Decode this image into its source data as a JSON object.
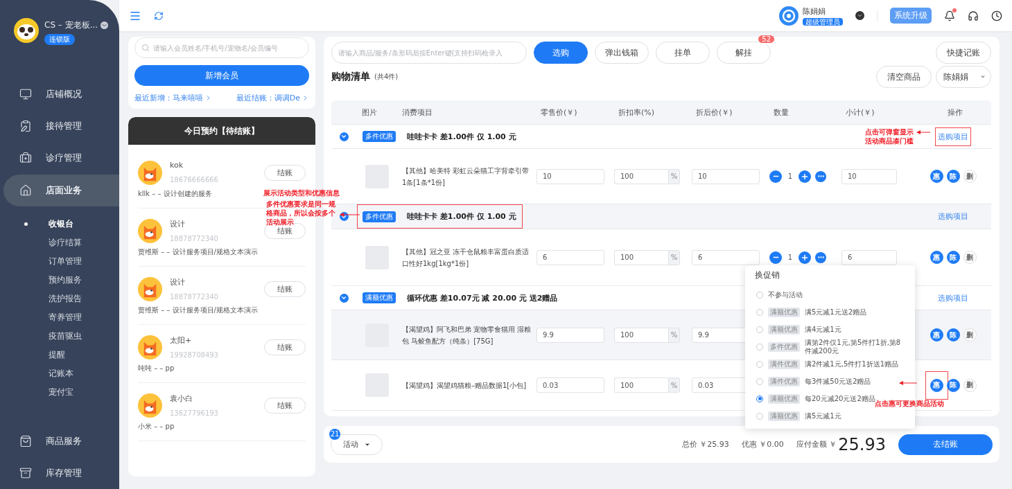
{
  "sidebar": {
    "brand": {
      "name": "CS – 宠老板...",
      "badge": "连锁版"
    },
    "menu": [
      {
        "label": "店铺概况",
        "selected": false
      },
      {
        "label": "接待管理",
        "selected": false
      },
      {
        "label": "诊疗管理",
        "selected": false
      },
      {
        "label": "店面业务",
        "selected": true,
        "expanded": true,
        "children": [
          {
            "label": "收银台",
            "selected": true
          },
          {
            "label": "诊疗结算",
            "selected": false
          },
          {
            "label": "订单管理",
            "selected": false
          },
          {
            "label": "预约服务",
            "selected": false
          },
          {
            "label": "洗护报告",
            "selected": false
          },
          {
            "label": "寄养管理",
            "selected": false
          },
          {
            "label": "疫苗驱虫",
            "selected": false
          },
          {
            "label": "提醒",
            "selected": false
          },
          {
            "label": "记账本",
            "selected": false
          },
          {
            "label": "宠付宝",
            "selected": false
          }
        ]
      },
      {
        "label": "商品服务",
        "selected": false
      },
      {
        "label": "库存管理",
        "selected": false
      }
    ]
  },
  "topbar": {
    "user": {
      "name": "陈娟娟",
      "role": "超级管理员"
    },
    "upgrade_button": "系统升级",
    "unread": true
  },
  "member_panel": {
    "search": {
      "placeholder": "请输入会员姓名/手机号/宠物名/会员编号"
    },
    "add_button": "新增会员",
    "recent_added": "最近新增：马来嘻嘻",
    "recent_checkout": "最近结账：调调De"
  },
  "appointments": {
    "title": "今日预约【待结账】",
    "items": [
      {
        "name": "kok",
        "phone": "18676666666",
        "service": "kllk – – 设计创建的服务",
        "button": "结账"
      },
      {
        "name": "设计",
        "phone": "18878772340",
        "service": "贾维斯 – – 设计服务项目/规格文本演示",
        "button": "结账"
      },
      {
        "name": "设计",
        "phone": "18878772340",
        "service": "贾维斯 – – 设计服务项目/规格文本演示",
        "button": "结账"
      },
      {
        "name": "太阳+",
        "phone": "19928708493",
        "service": "吨吨 – – pp",
        "button": "结账"
      },
      {
        "name": "袁小白",
        "phone": "13627796193",
        "service": "小米 – – pp",
        "button": "结账"
      }
    ]
  },
  "cart": {
    "search": {
      "placeholder": "请输入商品/服务/条形码后按Enter键(支持扫码枪录入"
    },
    "buttons": [
      {
        "label": "选购",
        "primary": true
      },
      {
        "label": "弹出钱箱",
        "primary": false
      },
      {
        "label": "挂单",
        "primary": false
      },
      {
        "label": "解挂",
        "primary": false,
        "badge": "52"
      }
    ],
    "quick_button": "快捷记账",
    "title": "购物清单",
    "count": "(共4件)",
    "clear_button": "清空商品",
    "staff_select": "陈娟娟",
    "columns": [
      "图片",
      "消费项目",
      "零售价(￥)",
      "折扣率(%)",
      "折后价(￥)",
      "数量",
      "小计(￥)",
      "操作"
    ],
    "rows": [
      {
        "kind": "group",
        "expanded": true,
        "tag": "多件优惠",
        "text": "哇哇卡卡 差1.00件 仅 1.00 元",
        "link": "选购项目",
        "highlighted": false,
        "framed": false,
        "link_framed": true
      },
      {
        "kind": "item",
        "name": "【其他】哈美特 彩虹云朵猫工字背牵引带 1条[1条*1份]",
        "retail": "10",
        "discount": "100",
        "unit": "%",
        "final": "10",
        "quantity": "1",
        "subtotal": "10",
        "actions": [
          "惠",
          "陈",
          "删"
        ],
        "highlighted": false,
        "action_framed": false
      },
      {
        "kind": "group",
        "expanded": true,
        "tag": "多件优惠",
        "text": "哇哇卡卡 差1.00件 仅 1.00 元",
        "link": "选购项目",
        "highlighted": true,
        "framed": true,
        "link_framed": false
      },
      {
        "kind": "item",
        "name": "【其他】冠之亚 冻干仓鼠粮丰富蛋白质适口性好1kg[1kg*1份]",
        "retail": "6",
        "discount": "100",
        "unit": "%",
        "final": "6",
        "quantity": "1",
        "subtotal": "6",
        "actions": [
          "惠",
          "陈",
          "删"
        ],
        "highlighted": false,
        "action_framed": false
      },
      {
        "kind": "group",
        "expanded": true,
        "tag": "满额优惠",
        "text": "循环优惠 差10.07元 减 20.00 元 送2赠品",
        "link": "选购项目",
        "highlighted": false,
        "framed": false,
        "link_framed": false
      },
      {
        "kind": "item",
        "name": "【渴望鸡】阿飞和巴弟 宠物零食猫用 湿粮包 马鲛鱼配方（纯条）[75G]",
        "retail": "9.9",
        "discount": "100",
        "unit": "%",
        "final": "9.9",
        "actions": [
          "惠",
          "陈",
          "删"
        ],
        "highlighted": true,
        "action_framed": false
      },
      {
        "kind": "item",
        "name": "【渴望鸡】渴望鸡猫粮–赠品数据1[小包]",
        "retail": "0.03",
        "discount": "100",
        "unit": "%",
        "final": "0.03",
        "actions": [
          "惠",
          "陈",
          "删"
        ],
        "highlighted": false,
        "action_framed": true
      }
    ]
  },
  "promo_popup": {
    "title": "换促销",
    "options": [
      {
        "text": "不参与活动",
        "selected": false
      },
      {
        "tag": "满额优惠",
        "text": "满5元减1元送2赠品",
        "selected": false
      },
      {
        "tag": "满额优惠",
        "text": "满4元减1元",
        "selected": false
      },
      {
        "tag": "多件优惠",
        "text": "满第2件仅1元,第5件打1折,第8件减200元",
        "selected": false
      },
      {
        "tag": "满件优惠",
        "text": "满2件减1元,5件打1折送1赠品",
        "selected": false
      },
      {
        "tag": "满件优惠",
        "text": "每3件减50元送2赠品",
        "selected": false
      },
      {
        "tag": "满额优惠",
        "text": "每20元减20元送2赠品",
        "selected": true
      },
      {
        "tag": "满额优惠",
        "text": "满5元减1元",
        "selected": false
      }
    ]
  },
  "footer": {
    "activity_button": "活动",
    "activity_badge": "21",
    "total": "总价 ￥25.93",
    "discount": "优惠 ￥0.00",
    "payable_label": "应付金额 ￥",
    "payable": "25.93",
    "checkout_button": "去结账"
  },
  "annotations": [
    {
      "text": "展示活动类型和优惠信息"
    },
    {
      "text": "多件优惠要求是同一规格商品，所以会按多个活动展示"
    },
    {
      "text": "点击可弹窗显示活动商品凑门槛"
    },
    {
      "text": "点击惠可更换商品活动"
    }
  ]
}
